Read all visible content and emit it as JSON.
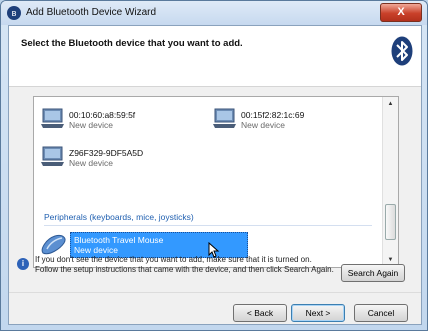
{
  "window": {
    "title": "Add Bluetooth Device Wizard",
    "close_label": "X"
  },
  "header": {
    "instruction": "Select the Bluetooth device that you want to add."
  },
  "devices": [
    {
      "name": "00:10:60:a8:59:5f",
      "status": "New device",
      "icon": "computer-icon"
    },
    {
      "name": "00:15f2:82:1c:69",
      "status": "New device",
      "icon": "computer-icon"
    },
    {
      "name": "Z96F329-9DF5A5D",
      "status": "New device",
      "icon": "computer-icon"
    }
  ],
  "category": {
    "label": "Peripherals (keyboards, mice, joysticks)"
  },
  "selected_device": {
    "name": "Bluetooth Travel Mouse",
    "status": "New device",
    "icon": "mouse-icon"
  },
  "info": {
    "text": "If you don't see the device that you want to add, make sure that it is turned on. Follow the setup instructions that came with the device, and then click Search Again."
  },
  "buttons": {
    "search_again": "Search Again",
    "back": "< Back",
    "next": "Next >",
    "cancel": "Cancel"
  },
  "colors": {
    "selection": "#3399ff",
    "category": "#1f5fb0",
    "bluetooth": "#1e3f7a"
  }
}
